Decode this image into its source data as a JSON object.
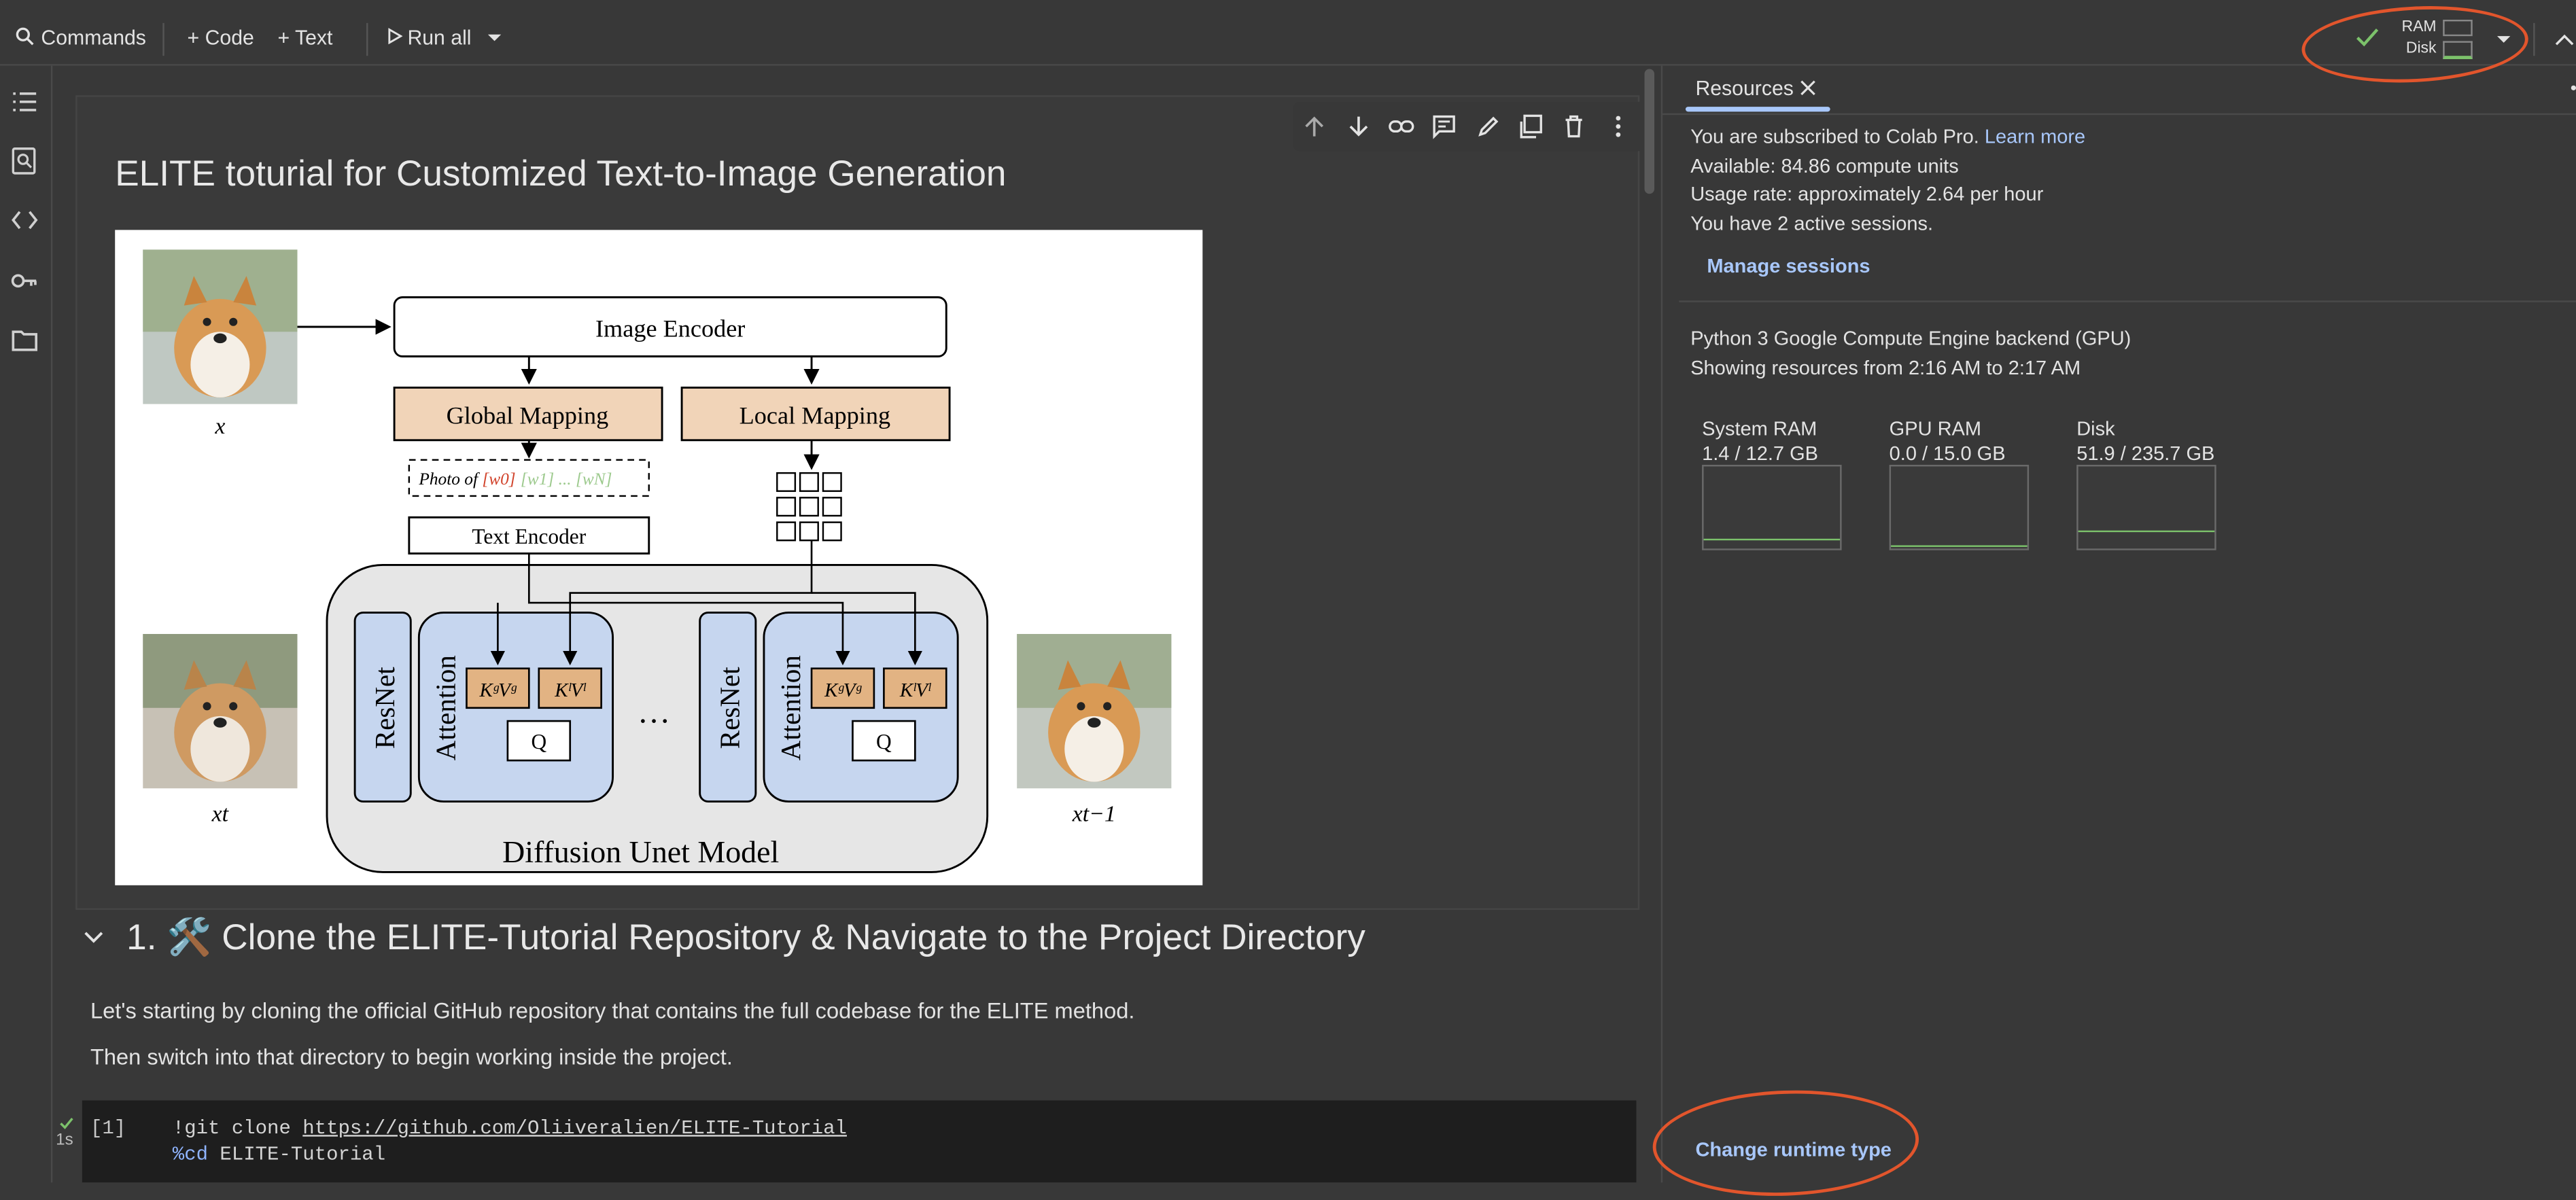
{
  "colors": {
    "accent": "#a8c7fa",
    "annotation": "#e2552c",
    "check": "#7cc26b",
    "figure_box": "#f1d4b8",
    "figure_blue": "#c6d6ef",
    "figure_gray": "#e6e6e6"
  },
  "toolbar": {
    "commands_label": "Commands",
    "code_label": "+ Code",
    "text_label": "+ Text",
    "run_all_label": "Run all",
    "ram_label": "RAM",
    "disk_label": "Disk"
  },
  "rail_icons": [
    "toc-icon",
    "find-icon",
    "code-snippets-icon",
    "secrets-key-icon",
    "files-folder-icon"
  ],
  "notebook": {
    "title": "ELITE toturial for Customized Text-to-Image Generation",
    "figure": {
      "image_encoder": "Image Encoder",
      "global_mapping": "Global Mapping",
      "local_mapping": "Local Mapping",
      "prompt_prefix": "Photo of ",
      "prompt_w0": "[w0]",
      "prompt_rest": "[w1] ... [wN]",
      "text_encoder": "Text Encoder",
      "resnet": "ResNet",
      "attention": "Attention",
      "kv_global": "KᵍVᵍ",
      "kv_local": "KˡVˡ",
      "q": "Q",
      "ellipsis": "…",
      "unet": "Diffusion Unet Model",
      "x": "x",
      "xt": "xt",
      "xt1": "xt−1"
    },
    "section_heading": "1. 🛠️ Clone the ELITE-Tutorial Repository & Navigate to the Project Directory",
    "para1": "Let's starting by cloning the official GitHub repository that contains the full codebase for the ELITE method.",
    "para2": "Then switch into that directory to begin working inside the project.",
    "code": {
      "exec_count": "[1]",
      "exec_time": "1s",
      "line1_cmd": "!git clone ",
      "line1_url": "https://github.com/Oliiveralien/ELITE-Tutorial",
      "line2_magic": "%cd",
      "line2_rest": " ELITE-Tutorial"
    }
  },
  "panel": {
    "tab_label": "Resources",
    "subscribed": "You are subscribed to Colab Pro. ",
    "learn_more": "Learn more",
    "available": "Available: 84.86 compute units",
    "usage": "Usage rate: approximately 2.64 per hour",
    "sessions": "You have 2 active sessions.",
    "manage_sessions": "Manage sessions",
    "backend": "Python 3 Google Compute Engine backend (GPU)",
    "showing": "Showing resources from 2:16 AM to 2:17 AM",
    "gauges": [
      {
        "name": "System RAM",
        "value": "1.4 / 12.7 GB",
        "fraction": 0.11
      },
      {
        "name": "GPU RAM",
        "value": "0.0 / 15.0 GB",
        "fraction": 0.0
      },
      {
        "name": "Disk",
        "value": "51.9 / 235.7 GB",
        "fraction": 0.22
      }
    ],
    "change_runtime": "Change runtime type"
  }
}
